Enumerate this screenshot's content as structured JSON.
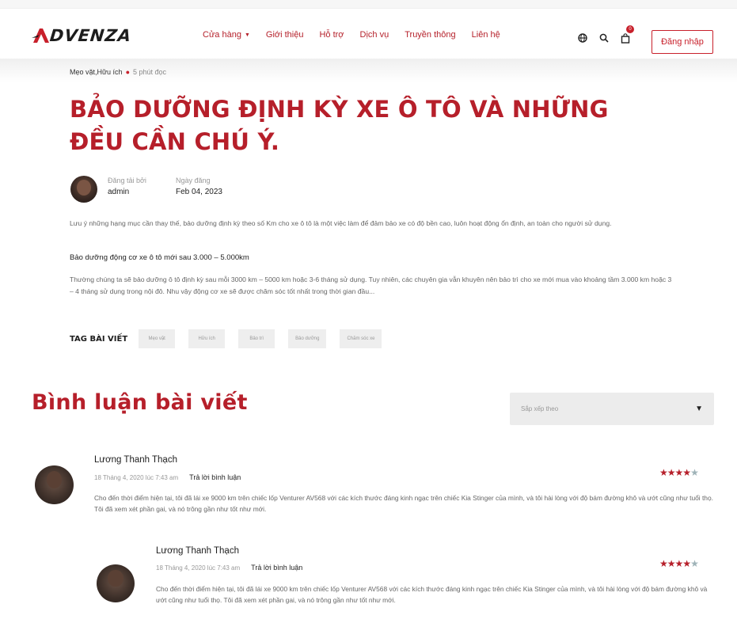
{
  "header": {
    "logo_text": "DVENZA",
    "nav": [
      {
        "label": "Cửa hàng",
        "has_dropdown": true
      },
      {
        "label": "Giới thiệu"
      },
      {
        "label": "Hỗ trợ"
      },
      {
        "label": "Dịch vụ"
      },
      {
        "label": "Truyền thông"
      },
      {
        "label": "Liên hệ"
      }
    ],
    "cart_count": "0",
    "login_label": "Đăng nhập",
    "icons": [
      "globe-icon",
      "search-icon",
      "cart-icon"
    ]
  },
  "article": {
    "breadcrumb": "Mẹo vặt,Hữu ích",
    "read_time": "5 phút đọc",
    "title": "BẢO DƯỠNG ĐỊNH KỲ XE Ô TÔ VÀ NHỮNG ĐỀU CẦN CHÚ Ý.",
    "author_label": "Đăng tải bởi",
    "author": "admin",
    "date_label": "Ngày đăng",
    "date": "Feb 04, 2023",
    "intro": "Lưu ý những hạng mục cần thay thế, bảo dưỡng định kỳ theo số Km cho xe ô tô là một việc làm để đảm bảo xe có độ bền cao, luôn hoạt động ổn định, an toàn cho người sử dụng.",
    "subheading": "Bảo dưỡng động cơ xe ô tô mới sau 3.000 – 5.000km",
    "body": "Thường chúng ta sẽ bảo dưỡng ô tô định kỳ sau mỗi 3000 km – 5000 km hoặc 3-6 tháng sử dụng. Tuy nhiên, các chuyên gia vẫn khuyên nên bảo trì cho xe mới mua vào khoảng tầm 3.000 km hoặc 3 – 4 tháng sử dụng trong nội đô. Nhu vậy động cơ xe sẽ được chăm sóc tốt nhất trong thời gian đầu...",
    "tags_label": "TAG BÀI VIẾT",
    "tags": [
      "Mẹo vặt",
      "Hữu ích",
      "Bảo trì",
      "Bảo dưỡng",
      "Chăm sóc xe"
    ]
  },
  "comments": {
    "title": "Bình luận bài viết",
    "sort_placeholder": "Sắp xếp theo",
    "items": [
      {
        "name": "Lương Thanh Thạch",
        "date": "18 Tháng 4, 2020 lúc 7:43 am",
        "reply_label": "Trả lời bình luận",
        "rating": 4,
        "max_rating": 5,
        "text": "Cho đến thời điểm hiện tại, tôi đã lái xe 9000 km trên chiếc lốp Venturer AV568 với các kích thước đáng kinh ngạc trên chiếc Kia Stinger của mình, và tôi hài lòng với độ bám đường khô và ướt cũng như tuổi thọ. Tôi đã xem xét phần gai, và nó trông gần như tốt như mới."
      },
      {
        "name": "Lương Thanh Thạch",
        "date": "18 Tháng 4, 2020 lúc 7:43 am",
        "reply_label": "Trả lời bình luận",
        "rating": 4,
        "max_rating": 5,
        "text": "Cho đến thời điểm hiện tại, tôi đã lái xe 9000 km trên chiếc lốp Venturer AV568 với các kích thước đáng kinh ngạc trên chiếc Kia Stinger của mình, và tôi hài lòng với độ bám đường khô và ướt cũng như tuổi thọ. Tôi đã xem xét phần gai, và nó trông gần như tốt như mới."
      }
    ]
  },
  "colors": {
    "brand_red": "#b61f2a",
    "star_off": "#9fb3b8"
  }
}
